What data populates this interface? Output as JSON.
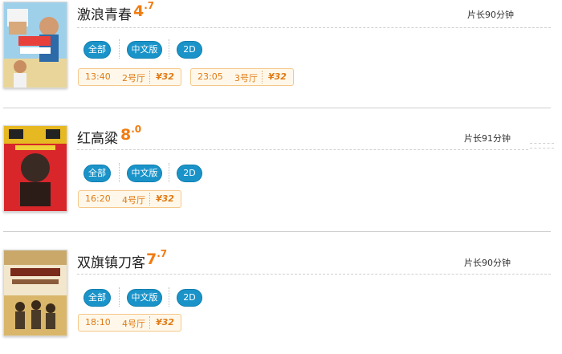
{
  "movies": [
    {
      "title": "激浪青春",
      "score_int": "4",
      "score_dec": ".7",
      "duration": "片长90分钟",
      "tags": [
        "全部",
        "中文版",
        "2D"
      ],
      "showtimes": [
        {
          "time": "13:40",
          "hall": "2号厅",
          "price": "¥32"
        },
        {
          "time": "23:05",
          "hall": "3号厅",
          "price": "¥32"
        }
      ]
    },
    {
      "title": "红高粱",
      "score_int": "8",
      "score_dec": ".0",
      "duration": "片长91分钟",
      "tags": [
        "全部",
        "中文版",
        "2D"
      ],
      "showtimes": [
        {
          "time": "16:20",
          "hall": "4号厅",
          "price": "¥32"
        }
      ]
    },
    {
      "title": "双旗镇刀客",
      "score_int": "7",
      "score_dec": ".7",
      "duration": "片长90分钟",
      "tags": [
        "全部",
        "中文版",
        "2D"
      ],
      "showtimes": [
        {
          "time": "18:10",
          "hall": "4号厅",
          "price": "¥32"
        }
      ]
    }
  ]
}
